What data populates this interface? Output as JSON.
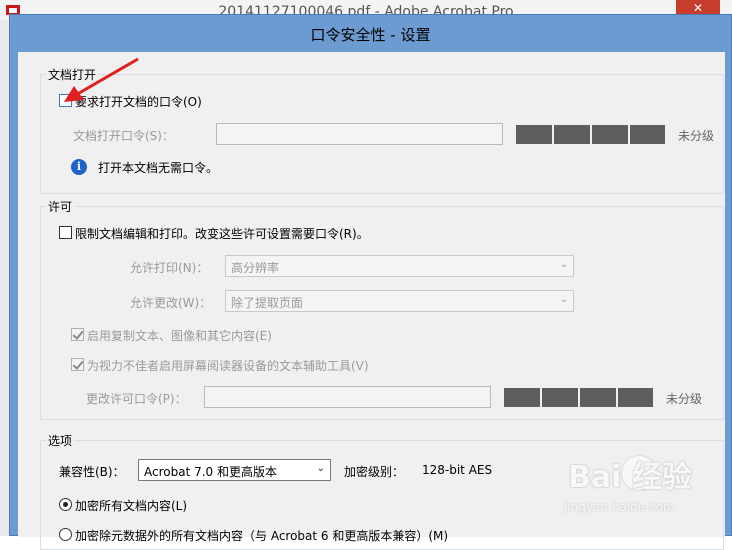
{
  "background_window": {
    "title": "20141127100046.pdf - Adobe Acrobat Pro",
    "close_glyph": "✕"
  },
  "dialog": {
    "title": "口令安全性 - 设置"
  },
  "document_open": {
    "legend": "文档打开",
    "require_password_label": "要求打开文档的口令(O)",
    "require_password_checked": false,
    "password_label": "文档打开口令(S)：",
    "password_value": "",
    "strength_label": "未分级",
    "info_icon": "info-icon",
    "info_text": "打开本文档无需口令。"
  },
  "permissions": {
    "legend": "许可",
    "restrict_label": "限制文档编辑和打印。改变这些许可设置需要口令(R)。",
    "restrict_checked": false,
    "printing_label": "允许打印(N)：",
    "printing_value": "高分辨率",
    "changes_label": "允许更改(W)：",
    "changes_value": "除了提取页面",
    "copy_label": "启用复制文本、图像和其它内容(E)",
    "copy_checked": true,
    "accessibility_label": "为视力不佳者启用屏幕阅读器设备的文本辅助工具(V)",
    "accessibility_checked": true,
    "change_password_label": "更改许可口令(P)：",
    "change_password_value": "",
    "strength_label": "未分级"
  },
  "options": {
    "legend": "选项",
    "compat_label": "兼容性(B)：",
    "compat_value": "Acrobat 7.0 和更高版本",
    "encryption_label": "加密级别：",
    "encryption_value": "128-bit AES",
    "radio_all_label": "加密所有文档内容(L)",
    "radio_all_selected": true,
    "radio_except_label": "加密除元数据外的所有文档内容（与 Acrobat 6 和更高版本兼容）(M)",
    "radio_except_selected": false
  },
  "watermark": {
    "text": "Bai 经验",
    "url": "jingyan.baidu.com"
  },
  "colors": {
    "dialog_frame": "#6b9bd1",
    "dialog_body": "#f0f0f0",
    "strength_meter": "#5e5e5e",
    "info_icon": "#1e63c8",
    "annotation_arrow": "#e02020"
  }
}
